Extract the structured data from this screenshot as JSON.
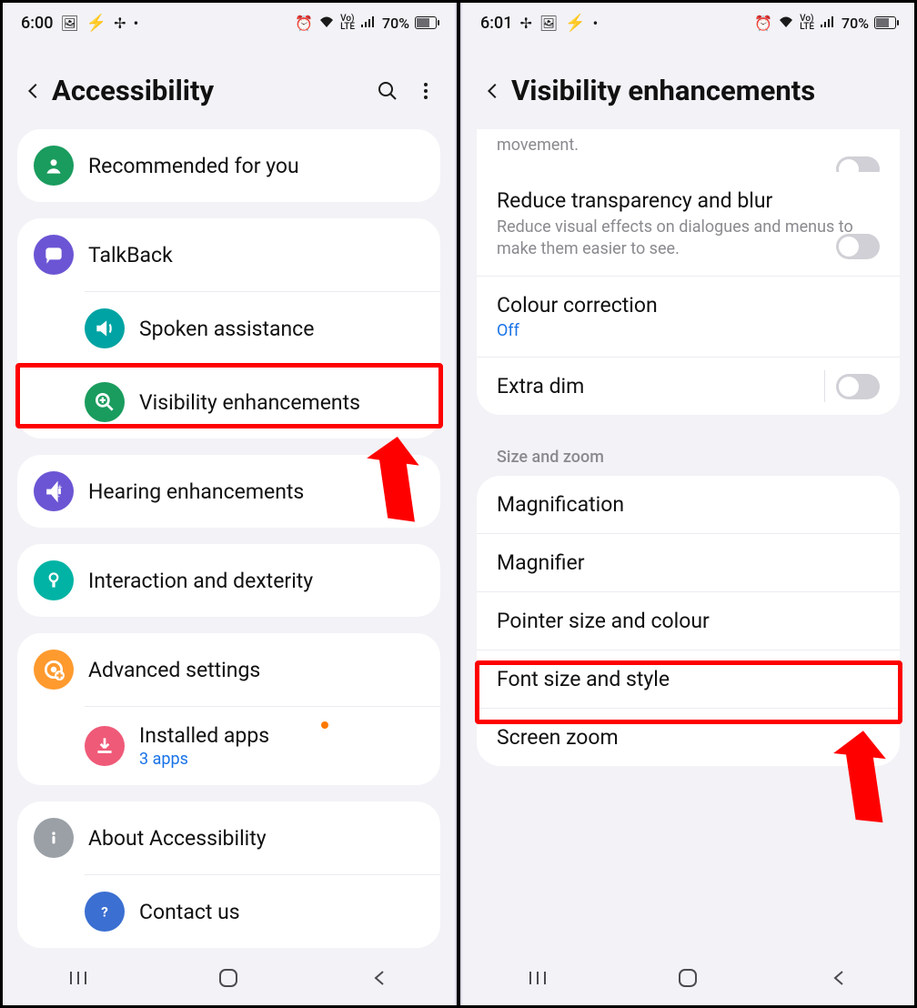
{
  "status": {
    "time_left": "6:00",
    "time_right": "6:01",
    "battery": "70%",
    "lte": "LTE",
    "vo": "Vo)"
  },
  "left": {
    "title": "Accessibility",
    "groups": [
      {
        "items": [
          {
            "icon": "person-circle",
            "color": "#1a9c5e",
            "label": "Recommended for you"
          }
        ]
      },
      {
        "items": [
          {
            "icon": "chat",
            "color": "#6c55d4",
            "label": "TalkBack"
          },
          {
            "icon": "sound",
            "color": "#00a3a3",
            "label": "Spoken assistance"
          },
          {
            "icon": "zoom",
            "color": "#1a9c5e",
            "label": "Visibility enhancements",
            "highlight": true
          }
        ]
      },
      {
        "items": [
          {
            "icon": "ear",
            "color": "#6c55d4",
            "label": "Hearing enhancements"
          }
        ]
      },
      {
        "items": [
          {
            "icon": "touch",
            "color": "#00b3a4",
            "label": "Interaction and dexterity"
          }
        ]
      },
      {
        "items": [
          {
            "icon": "gear-plus",
            "color": "#ff9a2e",
            "label": "Advanced settings"
          },
          {
            "icon": "download",
            "color": "#ef5a78",
            "label": "Installed apps",
            "sub": "3 apps",
            "badge": true
          }
        ]
      },
      {
        "items": [
          {
            "icon": "info",
            "color": "#9aa0a6",
            "label": "About Accessibility"
          },
          {
            "icon": "help",
            "color": "#3b6fd1",
            "label": "Contact us"
          }
        ]
      }
    ]
  },
  "right": {
    "title": "Visibility enhancements",
    "partial_top": "movement.",
    "settings1": [
      {
        "label": "Reduce transparency and blur",
        "desc": "Reduce visual effects on dialogues and menus to make them easier to see.",
        "toggle": true
      },
      {
        "label": "Colour correction",
        "value": "Off"
      },
      {
        "label": "Extra dim",
        "toggle": true,
        "toggle_divider": true
      }
    ],
    "section_header": "Size and zoom",
    "settings2": [
      {
        "label": "Magnification"
      },
      {
        "label": "Magnifier",
        "highlight": true
      },
      {
        "label": "Pointer size and colour"
      },
      {
        "label": "Font size and style"
      },
      {
        "label": "Screen zoom"
      }
    ]
  }
}
